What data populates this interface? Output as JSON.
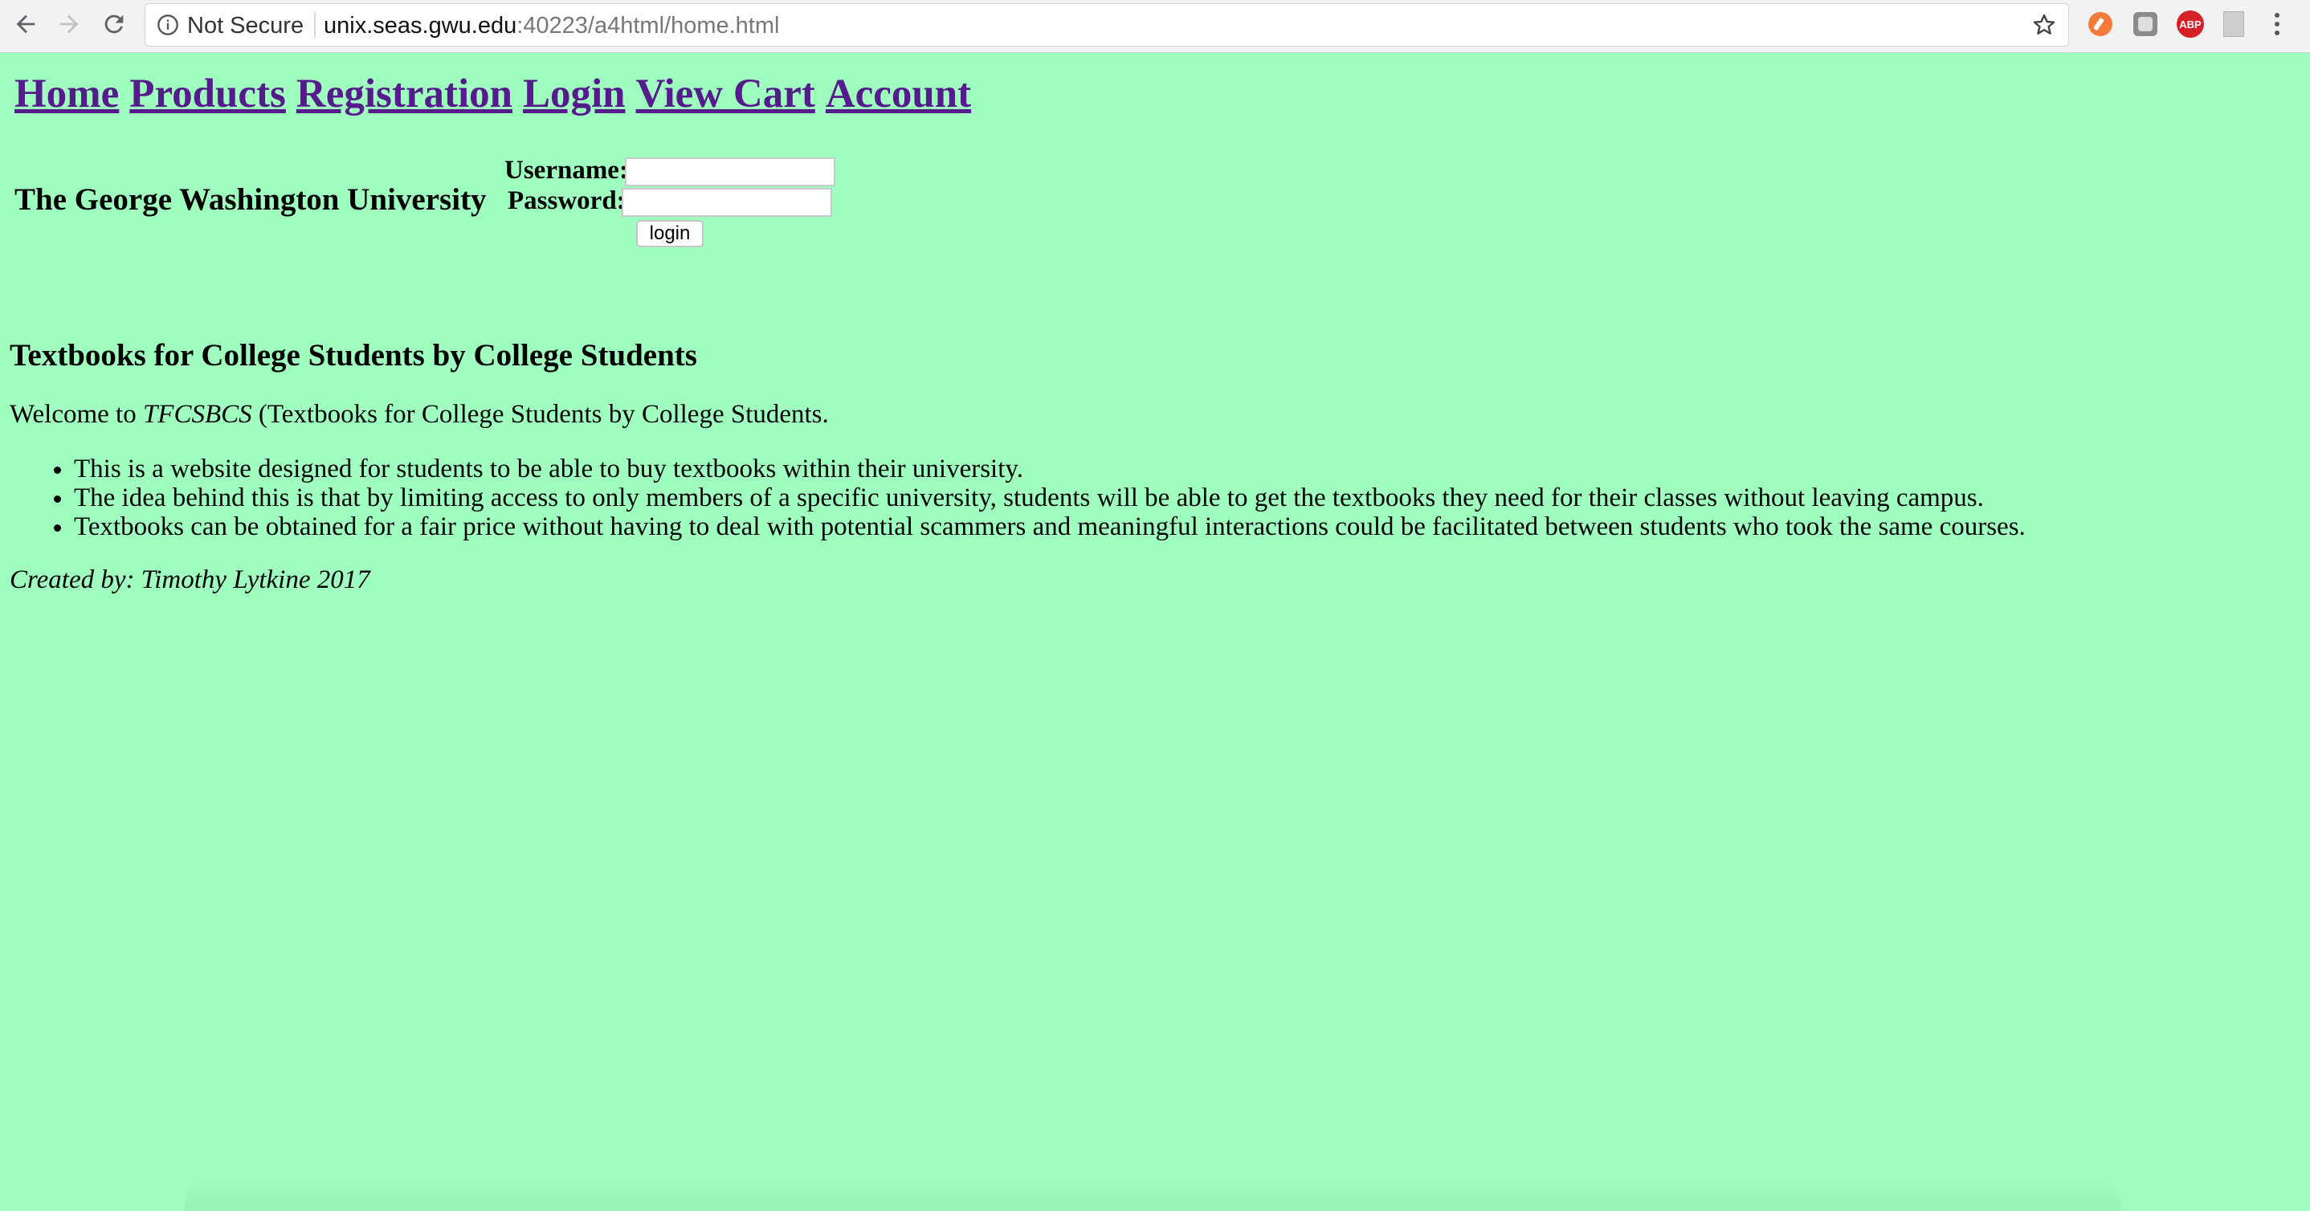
{
  "browser": {
    "security_label": "Not Secure",
    "url_host": "unix.seas.gwu.edu",
    "url_rest": ":40223/a4html/home.html",
    "icons": [
      "back-icon",
      "forward-icon",
      "reload-icon",
      "info-icon",
      "star-icon",
      "extension-icon",
      "extension-icon",
      "adblock-icon",
      "extension-icon",
      "menu-icon"
    ],
    "adblock_label": "ABP"
  },
  "nav": {
    "items": [
      {
        "label": "Home"
      },
      {
        "label": "Products"
      },
      {
        "label": "Registration"
      },
      {
        "label": "Login"
      },
      {
        "label": "View Cart"
      },
      {
        "label": "Account"
      }
    ]
  },
  "header": {
    "university": "The George Washington University",
    "username_label": "Username:",
    "password_label": "Password:",
    "username_value": "",
    "password_value": "",
    "login_button": "login"
  },
  "main": {
    "heading": "Textbooks for College Students by College Students",
    "welcome_prefix": "Welcome to ",
    "welcome_abbr": "TFCSBCS",
    "welcome_suffix": " (Textbooks for College Students by College Students.",
    "bullets": [
      "This is a website designed for students to be able to buy textbooks within their university.",
      "The idea behind this is that by limiting access to only members of a specific university, students will be able to get the textbooks they need for their classes without leaving campus.",
      "Textbooks can be obtained for a fair price without having to deal with potential scammers and meaningful interactions could be facilitated between students who took the same courses."
    ],
    "credits": "Created by: Timothy Lytkine 2017"
  },
  "colors": {
    "page_background": "#9effbe",
    "link_visited": "#551a8b"
  }
}
